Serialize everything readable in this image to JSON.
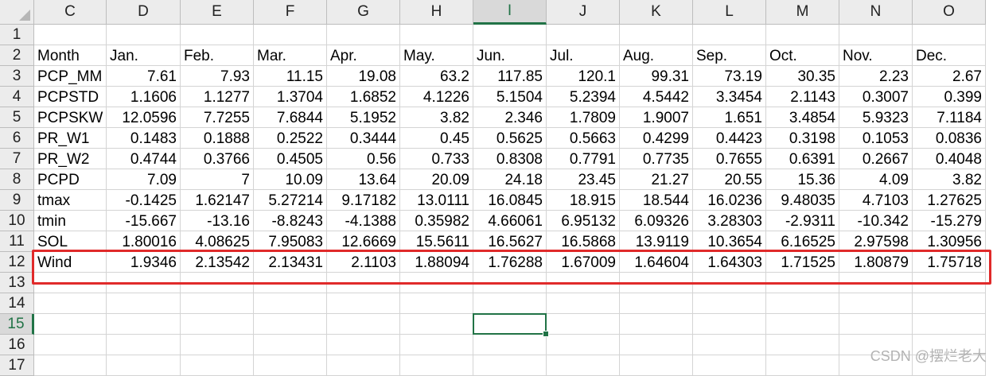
{
  "columns": [
    "C",
    "D",
    "E",
    "F",
    "G",
    "H",
    "I",
    "J",
    "K",
    "L",
    "M",
    "N",
    "O"
  ],
  "active_column": "I",
  "active_row": 15,
  "row_numbers": [
    1,
    2,
    3,
    4,
    5,
    6,
    7,
    8,
    9,
    10,
    11,
    12,
    13,
    14,
    15,
    16,
    17
  ],
  "highlighted_row": 12,
  "rows": [
    {
      "row": 1,
      "cells": [
        "",
        "",
        "",
        "",
        "",
        "",
        "",
        "",
        "",
        "",
        "",
        "",
        ""
      ]
    },
    {
      "row": 2,
      "cells": [
        "Month",
        "Jan.",
        "Feb.",
        "Mar.",
        "Apr.",
        "May.",
        "Jun.",
        "Jul.",
        "Aug.",
        "Sep.",
        "Oct.",
        "Nov.",
        "Dec."
      ]
    },
    {
      "row": 3,
      "cells": [
        "PCP_MM",
        "7.61",
        "7.93",
        "11.15",
        "19.08",
        "63.2",
        "117.85",
        "120.1",
        "99.31",
        "73.19",
        "30.35",
        "2.23",
        "2.67"
      ]
    },
    {
      "row": 4,
      "cells": [
        "PCPSTD",
        "1.1606",
        "1.1277",
        "1.3704",
        "1.6852",
        "4.1226",
        "5.1504",
        "5.2394",
        "4.5442",
        "3.3454",
        "2.1143",
        "0.3007",
        "0.399"
      ]
    },
    {
      "row": 5,
      "cells": [
        "PCPSKW",
        "12.0596",
        "7.7255",
        "7.6844",
        "5.1952",
        "3.82",
        "2.346",
        "1.7809",
        "1.9007",
        "1.651",
        "3.4854",
        "5.9323",
        "7.1184"
      ]
    },
    {
      "row": 6,
      "cells": [
        "PR_W1",
        "0.1483",
        "0.1888",
        "0.2522",
        "0.3444",
        "0.45",
        "0.5625",
        "0.5663",
        "0.4299",
        "0.4423",
        "0.3198",
        "0.1053",
        "0.0836"
      ]
    },
    {
      "row": 7,
      "cells": [
        "PR_W2",
        "0.4744",
        "0.3766",
        "0.4505",
        "0.56",
        "0.733",
        "0.8308",
        "0.7791",
        "0.7735",
        "0.7655",
        "0.6391",
        "0.2667",
        "0.4048"
      ]
    },
    {
      "row": 8,
      "cells": [
        "PCPD",
        "7.09",
        "7",
        "10.09",
        "13.64",
        "20.09",
        "24.18",
        "23.45",
        "21.27",
        "20.55",
        "15.36",
        "4.09",
        "3.82"
      ]
    },
    {
      "row": 9,
      "cells": [
        "tmax",
        "-0.1425",
        "1.62147",
        "5.27214",
        "9.17182",
        "13.0111",
        "16.0845",
        "18.915",
        "18.544",
        "16.0236",
        "9.48035",
        "4.7103",
        "1.27625"
      ]
    },
    {
      "row": 10,
      "cells": [
        "tmin",
        "-15.667",
        "-13.16",
        "-8.8243",
        "-4.1388",
        "0.35982",
        "4.66061",
        "6.95132",
        "6.09326",
        "3.28303",
        "-2.9311",
        "-10.342",
        "-15.279"
      ]
    },
    {
      "row": 11,
      "cells": [
        "SOL",
        "1.80016",
        "4.08625",
        "7.95083",
        "12.6669",
        "15.5611",
        "16.5627",
        "16.5868",
        "13.9119",
        "10.3654",
        "6.16525",
        "2.97598",
        "1.30956"
      ]
    },
    {
      "row": 12,
      "cells": [
        "Wind",
        "1.9346",
        "2.13542",
        "2.13431",
        "2.1103",
        "1.88094",
        "1.76288",
        "1.67009",
        "1.64604",
        "1.64303",
        "1.71525",
        "1.80879",
        "1.75718"
      ]
    },
    {
      "row": 13,
      "cells": [
        "",
        "",
        "",
        "",
        "",
        "",
        "",
        "",
        "",
        "",
        "",
        "",
        ""
      ]
    },
    {
      "row": 14,
      "cells": [
        "",
        "",
        "",
        "",
        "",
        "",
        "",
        "",
        "",
        "",
        "",
        "",
        ""
      ]
    },
    {
      "row": 15,
      "cells": [
        "",
        "",
        "",
        "",
        "",
        "",
        "",
        "",
        "",
        "",
        "",
        "",
        ""
      ]
    },
    {
      "row": 16,
      "cells": [
        "",
        "",
        "",
        "",
        "",
        "",
        "",
        "",
        "",
        "",
        "",
        "",
        ""
      ]
    },
    {
      "row": 17,
      "cells": [
        "",
        "",
        "",
        "",
        "",
        "",
        "",
        "",
        "",
        "",
        "",
        "",
        ""
      ]
    }
  ],
  "colors": {
    "selection": "#217346",
    "highlight_box": "#e02a2a",
    "header_bg": "#ececec",
    "gridline": "#d4d4d4"
  },
  "watermark": "CSDN @摆烂老大"
}
